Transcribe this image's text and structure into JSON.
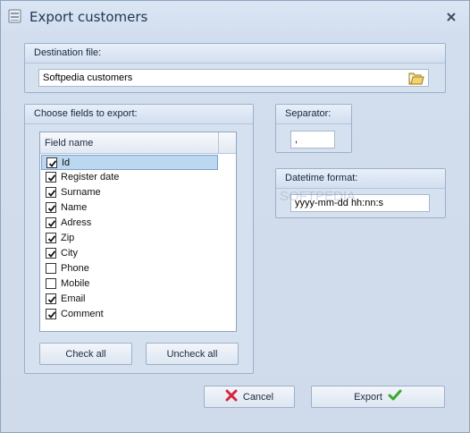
{
  "window": {
    "title": "Export customers"
  },
  "destination": {
    "label": "Destination file:",
    "value": "Softpedia customers"
  },
  "fields": {
    "label": "Choose fields to export:",
    "column_header": "Field name",
    "items": [
      {
        "label": "Id",
        "checked": true,
        "selected": true
      },
      {
        "label": "Register date",
        "checked": true
      },
      {
        "label": "Surname",
        "checked": true
      },
      {
        "label": "Name",
        "checked": true
      },
      {
        "label": "Adress",
        "checked": true
      },
      {
        "label": "Zip",
        "checked": true
      },
      {
        "label": "City",
        "checked": true
      },
      {
        "label": "Phone",
        "checked": false
      },
      {
        "label": "Mobile",
        "checked": false
      },
      {
        "label": "Email",
        "checked": true
      },
      {
        "label": "Comment",
        "checked": true
      }
    ],
    "check_all_label": "Check all",
    "uncheck_all_label": "Uncheck all"
  },
  "separator": {
    "label": "Separator:",
    "value": ","
  },
  "datetime": {
    "label": "Datetime format:",
    "value": "yyyy-mm-dd hh:nn:s"
  },
  "footer": {
    "cancel_label": "Cancel",
    "export_label": "Export"
  },
  "watermark": "SOFTPEDIA",
  "colors": {
    "accent": "#bcd7f0",
    "cancel": "#d6263b",
    "export": "#3aa832"
  }
}
